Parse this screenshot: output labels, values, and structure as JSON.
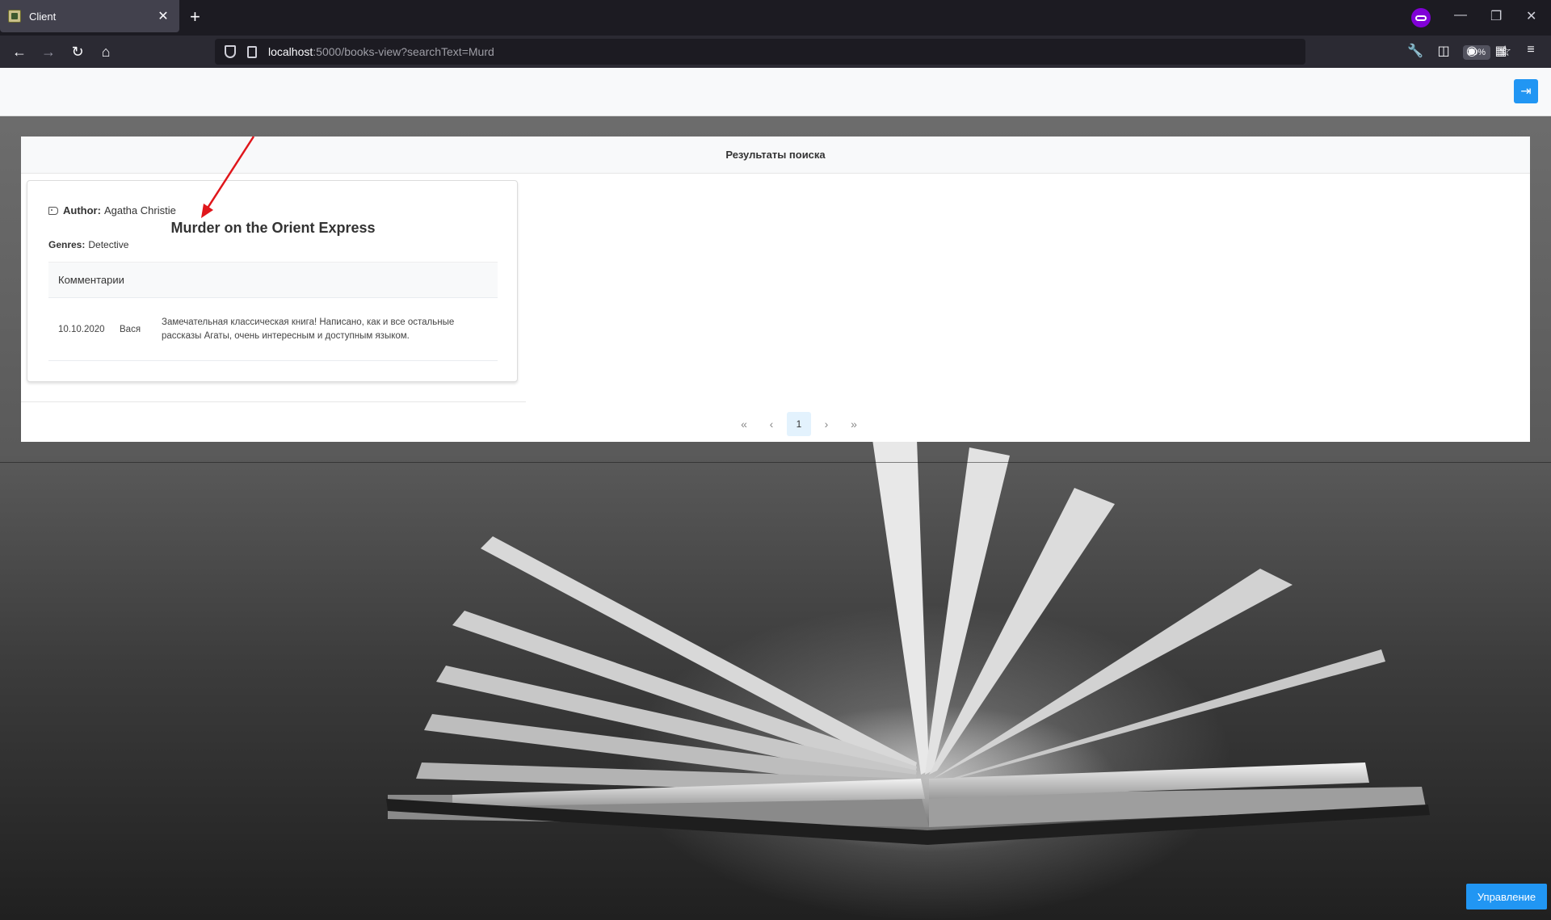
{
  "browser": {
    "tab_title": "Client",
    "tab_close": "✕",
    "new_tab": "+",
    "url_host": "localhost",
    "url_rest": ":5000/books-view?searchText=Murd",
    "zoom": "80%"
  },
  "header": {
    "login_icon": "login-icon"
  },
  "results": {
    "title": "Результаты поиска"
  },
  "book": {
    "author_label": "Author:",
    "author": "Agatha Christie",
    "title": "Murder on the Orient Express",
    "genres_label": "Genres:",
    "genres": "Detective"
  },
  "comments": {
    "header": "Комментарии",
    "rows": [
      {
        "date": "10.10.2020",
        "user": "Вася",
        "text": "Замечательная классическая книга! Написано, как и все остальные рассказы Агаты, очень интересным и доступным языком."
      }
    ]
  },
  "pagination": {
    "first": "«",
    "prev": "‹",
    "current": "1",
    "next": "›",
    "last": "»"
  },
  "manage_button": "Управление",
  "colors": {
    "accent": "#2196f3",
    "annotation_arrow": "#e0161b"
  }
}
